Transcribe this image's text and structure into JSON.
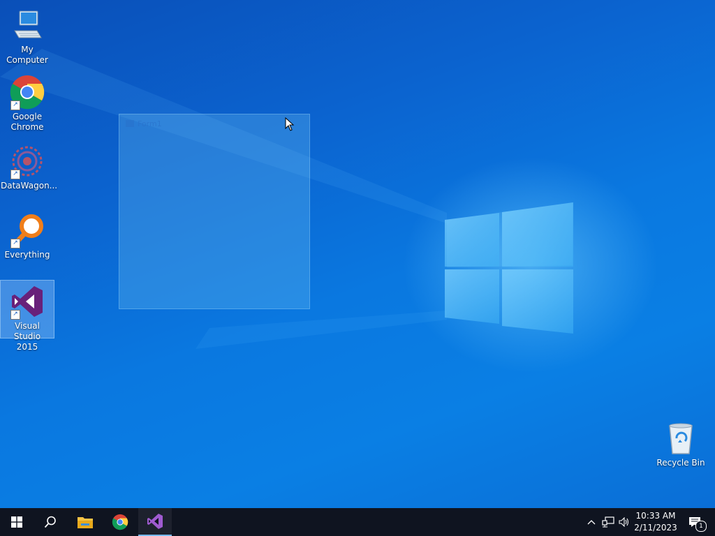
{
  "desktop": {
    "icons": [
      {
        "label": "My Computer"
      },
      {
        "label": "Google Chrome"
      },
      {
        "label": "DataWagon..."
      },
      {
        "label": "Everything"
      },
      {
        "label": "Visual Studio 2015"
      },
      {
        "label": "Recycle Bin"
      }
    ],
    "ghost_window_title": "Form1"
  },
  "taskbar": {
    "pinned": [
      {
        "name": "Start",
        "icon": "windows-logo-icon"
      },
      {
        "name": "Search",
        "icon": "search-icon"
      },
      {
        "name": "File Explorer",
        "icon": "folder-icon"
      },
      {
        "name": "Google Chrome",
        "icon": "chrome-icon"
      },
      {
        "name": "Visual Studio",
        "icon": "visual-studio-icon",
        "active": true
      }
    ],
    "clock": {
      "time": "10:33 AM",
      "date": "2/11/2023"
    },
    "notification_count": "1"
  },
  "colors": {
    "desktop_blue": "#0a78e0",
    "taskbar": "#0f1420",
    "active_indicator": "#76b9ed",
    "vs_purple": "#68217a"
  }
}
